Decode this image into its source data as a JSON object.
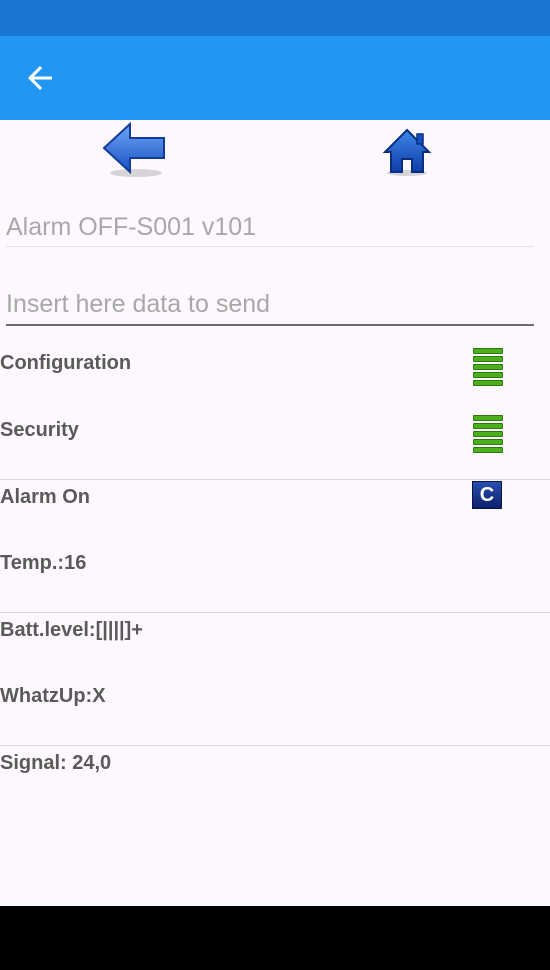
{
  "app": {
    "device_title": "Alarm OFF-S001 v101",
    "send_placeholder": "Insert here data to send"
  },
  "rows": {
    "configuration": "Configuration",
    "security": "Security",
    "alarm": "Alarm On",
    "alarm_button": "C",
    "temp": "Temp.:16",
    "battery": "Batt.level:[||||]+",
    "whatzup": "WhatzUp:X",
    "signal": "Signal: 24,0"
  },
  "colors": {
    "statusbar": "#1976d2",
    "appbar": "#2196f3",
    "background": "#fdf8fd"
  },
  "icons": {
    "appbar_back": "arrow-left-icon",
    "toolbar_back": "blue-arrow-left-icon",
    "toolbar_home": "home-icon",
    "menu": "green-menu-icon"
  }
}
